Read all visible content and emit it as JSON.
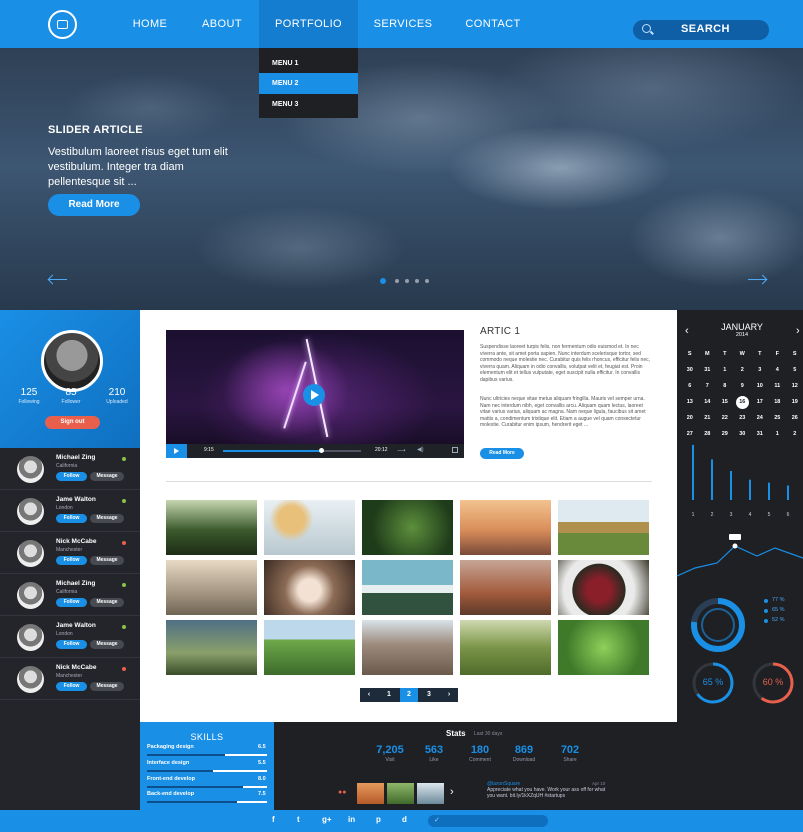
{
  "nav": {
    "items": [
      "HOME",
      "ABOUT",
      "PORTFOLIO",
      "SERVICES",
      "CONTACT"
    ],
    "active": "PORTFOLIO",
    "search_label": "SEARCH",
    "dropdown": [
      "MENU 1",
      "MENU 2",
      "MENU 3"
    ],
    "dropdown_active": "MENU 2"
  },
  "hero": {
    "title": "SLIDER ARTICLE",
    "text": "Vestibulum laoreet risus eget tum elit vestibulum. Integer tra diam pellentesque sit ...",
    "button": "Read More",
    "slide_count": 5,
    "active_slide": 1
  },
  "profile": {
    "stats": [
      {
        "value": "125",
        "label": "Following"
      },
      {
        "value": "85",
        "label": "Follower"
      },
      {
        "value": "210",
        "label": "Uploaded"
      }
    ],
    "signout": "Sign out"
  },
  "users": [
    {
      "name": "Michael Zing",
      "location": "California",
      "status_color": "#8bc34a"
    },
    {
      "name": "Jame Walton",
      "location": "London",
      "status_color": "#8bc34a"
    },
    {
      "name": "Nick McCabe",
      "location": "Manchester",
      "status_color": "#e8604c"
    },
    {
      "name": "Michael Zing",
      "location": "California",
      "status_color": "#8bc34a"
    },
    {
      "name": "Jame Walton",
      "location": "London",
      "status_color": "#8bc34a"
    },
    {
      "name": "Nick McCabe",
      "location": "Manchester",
      "status_color": "#e8604c"
    }
  ],
  "user_buttons": {
    "follow": "Follow",
    "message": "Message"
  },
  "video": {
    "time_current": "9:15",
    "time_total": "20:12",
    "progress": 0.71
  },
  "article": {
    "title": "ARTIC 1",
    "p1": "Suspendisse laoreet turpis felis, non fermentum odio euismod et. In nec viverra ante, sit amet porta sapien. Nunc interdum scelerisque tortor, sed commodo neque molestie nec. Curabitur quis felis rhoncus, efficitur felis nec, viverra quam. Aliquam in odio convallis, volutpat velit et, feugiat est. Proin elementum elit et tellus vulputate, eget suscipit nulla efficitur. In convallis dapibus varius.",
    "p2": "Nunc ultricies neque vitae metus aliquam fringilla. Mauris vel semper urna. Nam nec interdum nibh, eget convallis arcu. Aliquam quam lectus, laoreet vitae varius varius, aliquam ac magna. Nam neque ligula, faucibus sit amet mattis a, condimentum tristique elit. Etiam a augue vel quam consectetur molestie. Curabitur enim ipsum, hendrerit eget ...",
    "button": "Read More"
  },
  "pagination": {
    "prev": "‹",
    "pages": [
      "1",
      "2",
      "3"
    ],
    "active": "2",
    "next": "›"
  },
  "calendar": {
    "month": "JANUARY",
    "year": "2014",
    "weekdays": [
      "S",
      "M",
      "T",
      "W",
      "T",
      "F",
      "S"
    ],
    "rows": [
      [
        "30",
        "31",
        "1",
        "2",
        "3",
        "4",
        "5"
      ],
      [
        "6",
        "7",
        "8",
        "9",
        "10",
        "11",
        "12"
      ],
      [
        "13",
        "14",
        "15",
        "16",
        "17",
        "18",
        "19"
      ],
      [
        "20",
        "21",
        "22",
        "23",
        "24",
        "25",
        "26"
      ],
      [
        "27",
        "28",
        "29",
        "30",
        "31",
        "1",
        "2"
      ]
    ],
    "today": "16"
  },
  "bar_chart": {
    "labels": [
      "1",
      "2",
      "3",
      "4",
      "5",
      "6"
    ],
    "values": [
      0.95,
      0.7,
      0.5,
      0.35,
      0.3,
      0.25
    ]
  },
  "donut": {
    "legend": [
      "77 %",
      "65 %",
      "52 %"
    ]
  },
  "rings": [
    {
      "label": "65 %",
      "value": 65,
      "color": "#1a8fe6"
    },
    {
      "label": "60 %",
      "value": 60,
      "color": "#e8604c"
    }
  ],
  "skills": {
    "title": "SKILLS",
    "items": [
      {
        "name": "Packaging design",
        "value": "6.5"
      },
      {
        "name": "Interface design",
        "value": "5.5"
      },
      {
        "name": "Front-end develop",
        "value": "8.0"
      },
      {
        "name": "Back-end develop",
        "value": "7.5"
      }
    ]
  },
  "stats": {
    "title": "Stats",
    "subtitle": "Last 30 days",
    "items": [
      {
        "value": "7,205",
        "label": "Visit"
      },
      {
        "value": "563",
        "label": "Like"
      },
      {
        "value": "180",
        "label": "Comment"
      },
      {
        "value": "869",
        "label": "Download"
      },
      {
        "value": "702",
        "label": "Share"
      }
    ]
  },
  "tweet": {
    "handle": "@laxonSquare",
    "date": "Apr 10",
    "text": "Appreciate what you have. Work your ass off for what you want. bit.ly/1kXZqUH #startups"
  },
  "footer": {
    "social": [
      "f",
      "t",
      "g+",
      "in",
      "p",
      "d"
    ]
  }
}
